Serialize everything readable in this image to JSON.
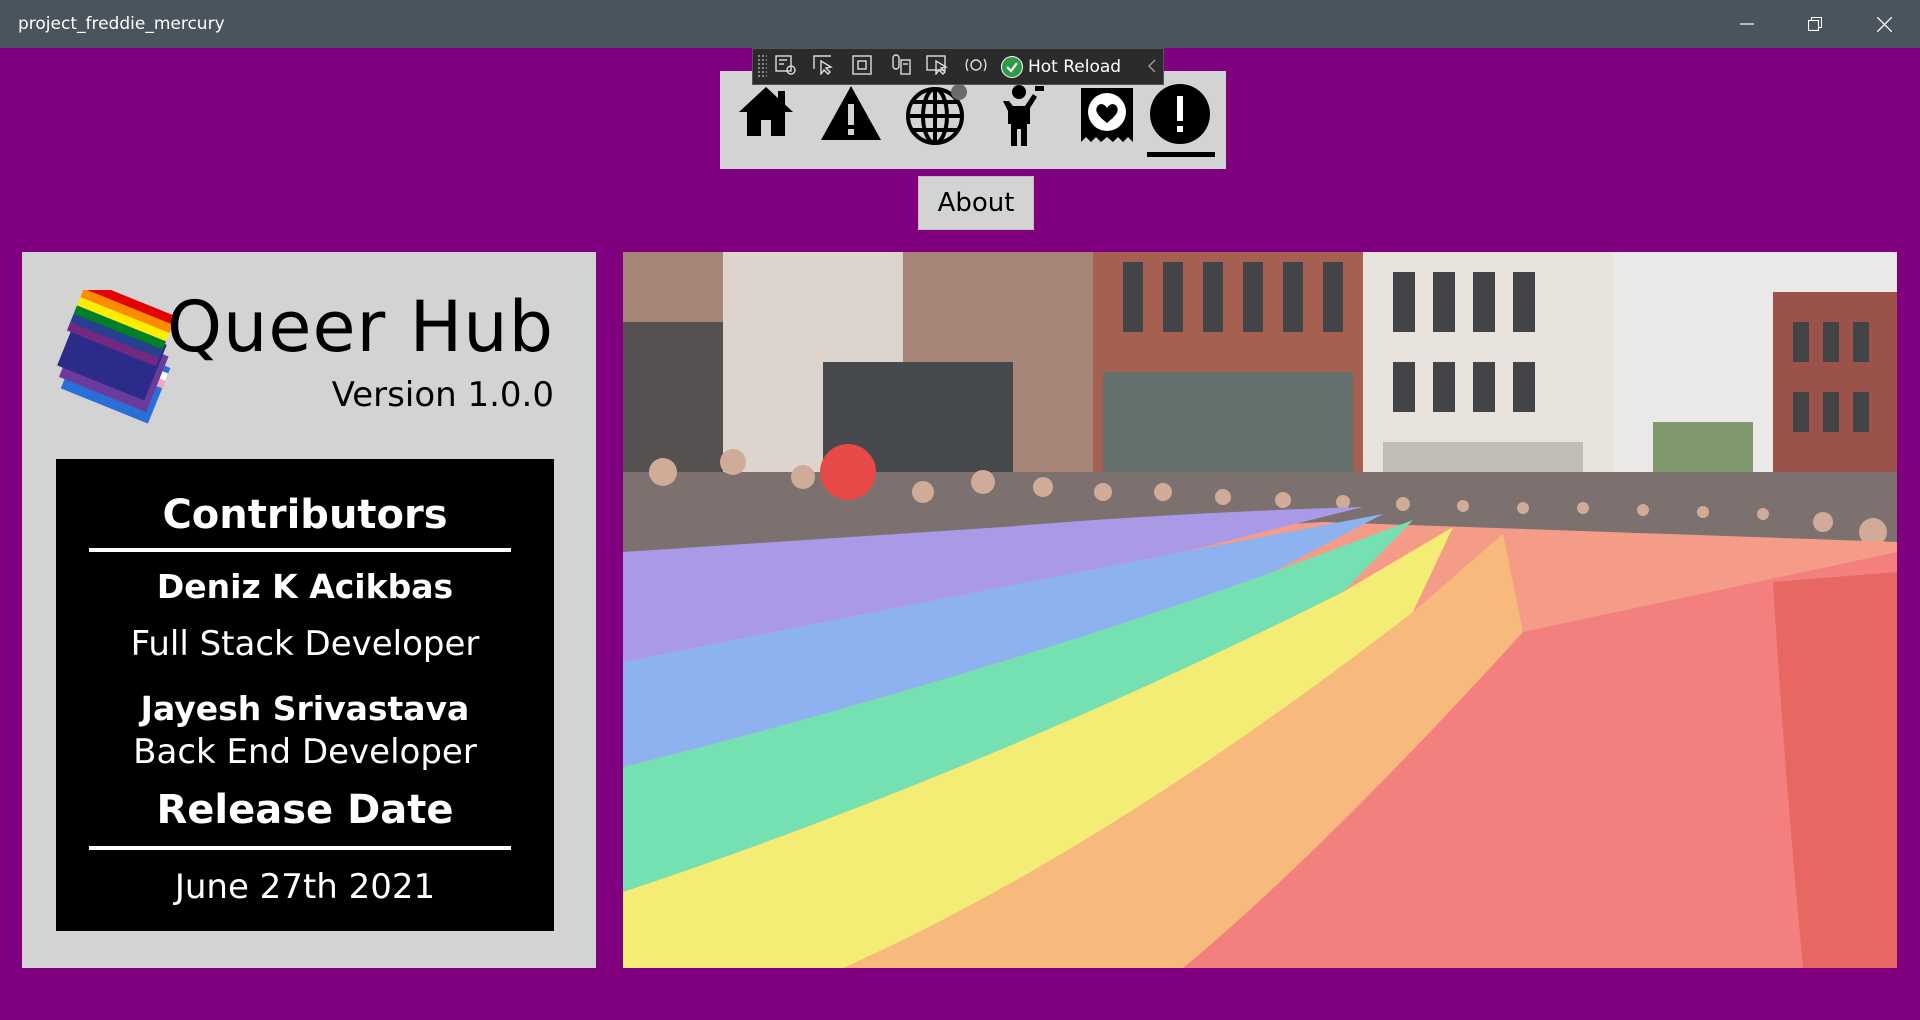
{
  "window": {
    "title": "project_freddie_mercury",
    "controls": [
      "minimize-icon",
      "restore-icon",
      "close-icon"
    ]
  },
  "devtools": {
    "tools": [
      "live-visual-tree-icon",
      "select-element-icon",
      "display-layout-adorners-icon",
      "track-focus-icon",
      "binding-failures-icon",
      "hot-reload-status-icon"
    ],
    "hot_reload_label": "Hot Reload"
  },
  "nav": {
    "items": [
      {
        "name": "home",
        "icon": "home-icon"
      },
      {
        "name": "warning",
        "icon": "warning-icon"
      },
      {
        "name": "globe",
        "icon": "globe-icon"
      },
      {
        "name": "person",
        "icon": "person-icon"
      },
      {
        "name": "heart",
        "icon": "heart-badge-icon"
      },
      {
        "name": "about",
        "icon": "exclamation-icon",
        "selected": true
      }
    ],
    "current_page_label": "About"
  },
  "about": {
    "app_name": "Queer Hub",
    "version": "Version 1.0.0",
    "contributors_heading": "Contributors",
    "contributors": [
      {
        "name": "Deniz K Acikbas",
        "role": "Full Stack Developer"
      },
      {
        "name": "Jayesh Srivastava",
        "role": "Back End Developer"
      }
    ],
    "release_heading": "Release Date",
    "release_date": "June 27th 2021"
  },
  "colors": {
    "background": "#800080",
    "panel": "#d3d3d3",
    "titlebar": "#4a545c",
    "credits_bg": "#000000"
  }
}
